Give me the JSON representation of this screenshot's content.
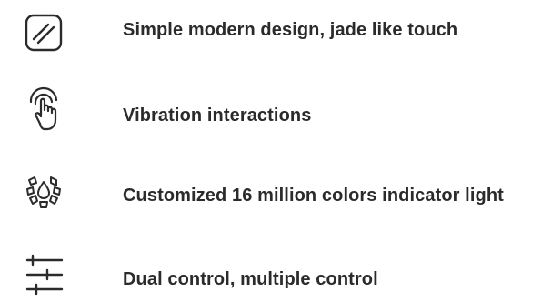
{
  "features": [
    {
      "icon": "slash-square-icon",
      "label": "Simple modern design, jade like touch"
    },
    {
      "icon": "vibration-touch-icon",
      "label": "Vibration interactions"
    },
    {
      "icon": "color-light-ring-icon",
      "label": "Customized 16 million colors indicator light"
    },
    {
      "icon": "control-sliders-icon",
      "label": "Dual control, multiple control"
    }
  ],
  "colors": {
    "text": "#2b2b2b",
    "icon": "#2b2b2b",
    "background": "#ffffff"
  }
}
